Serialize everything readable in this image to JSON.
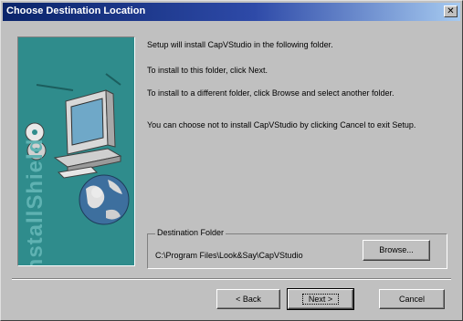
{
  "window": {
    "title": "Choose Destination Location",
    "close_glyph": "✕"
  },
  "banner": {
    "word": "InstallShield",
    "icons": [
      "computer-icon",
      "cd-icon",
      "globe-icon"
    ]
  },
  "messages": {
    "line1": "Setup will install CapVStudio in the following folder.",
    "line2": "To install to this folder, click Next.",
    "line3": "To install to a different folder, click Browse and select another folder.",
    "line4": "You can choose not to install CapVStudio by clicking Cancel to exit Setup."
  },
  "destination": {
    "legend": "Destination Folder",
    "path": "C:\\Program Files\\Look&Say\\CapVStudio",
    "browse_label": "Browse..."
  },
  "buttons": {
    "back": "< Back",
    "next": "Next >",
    "cancel": "Cancel"
  },
  "colors": {
    "title_start": "#0a246a",
    "title_end": "#a6caf0",
    "banner": "#2f8c8c",
    "face": "#c0c0c0"
  }
}
